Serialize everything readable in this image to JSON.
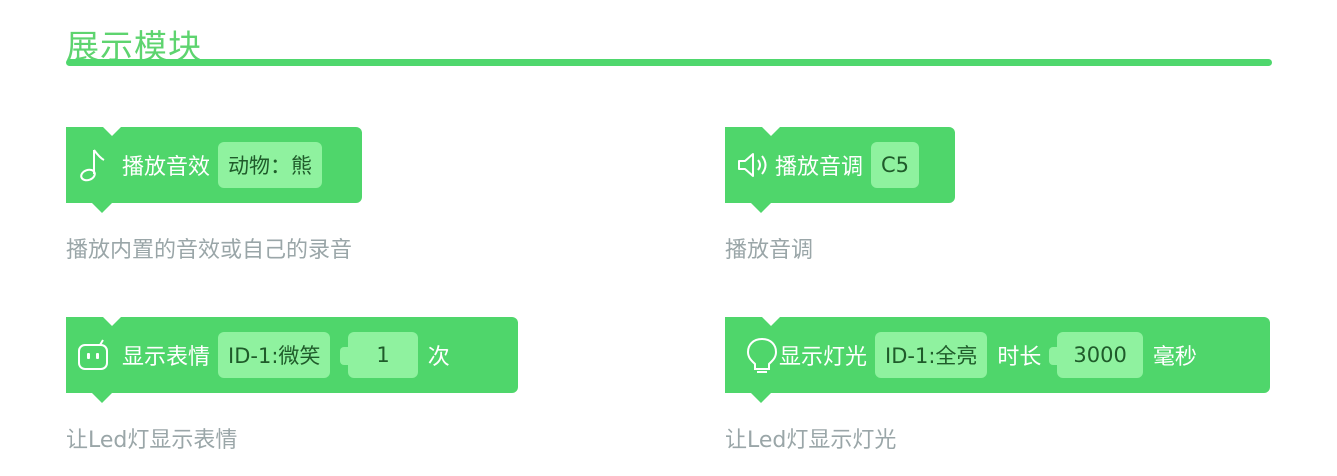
{
  "section_title": "展示模块",
  "blocks": {
    "sound": {
      "label": "播放音效",
      "value": "动物：熊",
      "description": "播放内置的音效或自己的录音",
      "icon": "music-note-icon"
    },
    "tone": {
      "label": "播放音调",
      "value": "C5",
      "description": "播放音调",
      "icon": "speaker-icon"
    },
    "expression": {
      "label": "显示表情",
      "value": "ID-1:微笑",
      "count": "1",
      "unit": "次",
      "description": "让Led灯显示表情",
      "icon": "robot-face-icon"
    },
    "light": {
      "label": "显示灯光",
      "value": "ID-1:全亮",
      "duration_label": "时长",
      "duration": "3000",
      "unit": "毫秒",
      "description": "让Led灯显示灯光",
      "icon": "bulb-icon"
    }
  },
  "colors": {
    "block": "#4fd66b",
    "field": "#8ff29f",
    "title": "#5ed46f",
    "description": "#9aa6a8"
  }
}
